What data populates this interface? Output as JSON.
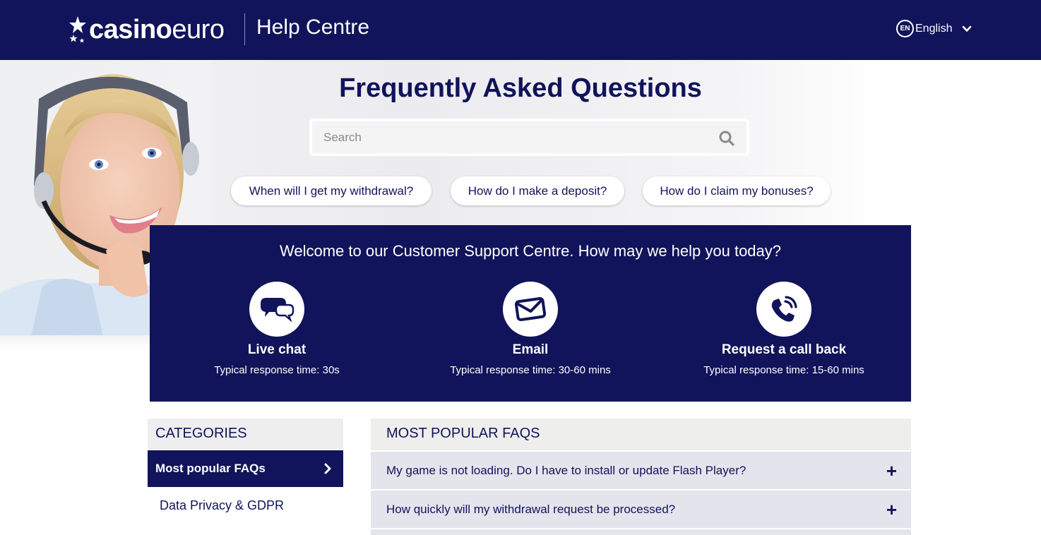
{
  "header": {
    "logo_bold": "casino",
    "logo_light": "euro",
    "section_title": "Help Centre",
    "language": {
      "badge": "EN",
      "label": "English",
      "icon": "chevron-down-icon"
    }
  },
  "hero": {
    "title": "Frequently Asked Questions",
    "search": {
      "placeholder": "Search",
      "value": "",
      "icon": "search-icon"
    },
    "quick_links": [
      "When will I get my withdrawal?",
      "How do I make a deposit?",
      "How do I claim my bonuses?"
    ],
    "image": "customer-support-agent-with-headset"
  },
  "support": {
    "welcome": "Welcome to our Customer Support Centre. How may we help you today?",
    "channels": [
      {
        "name": "Live chat",
        "time": "Typical response time: 30s",
        "icon": "chat-bubbles-icon"
      },
      {
        "name": "Email",
        "time": "Typical response time: 30-60 mins",
        "icon": "envelope-icon"
      },
      {
        "name": "Request a call back",
        "time": "Typical response time: 15-60 mins",
        "icon": "phone-ringing-icon"
      }
    ]
  },
  "categories": {
    "heading": "CATEGORIES",
    "items": [
      {
        "label": "Most popular FAQs",
        "active": true
      },
      {
        "label": "Data Privacy & GDPR",
        "active": false
      }
    ]
  },
  "faqs": {
    "heading": "MOST POPULAR FAQS",
    "items": [
      "My game is not loading. Do I have to install or update Flash Player?",
      "How quickly will my withdrawal request be processed?"
    ]
  },
  "colors": {
    "brand_navy": "#11145a",
    "panel_grey": "#eeeeee",
    "faq_row": "#e4e4ec"
  }
}
